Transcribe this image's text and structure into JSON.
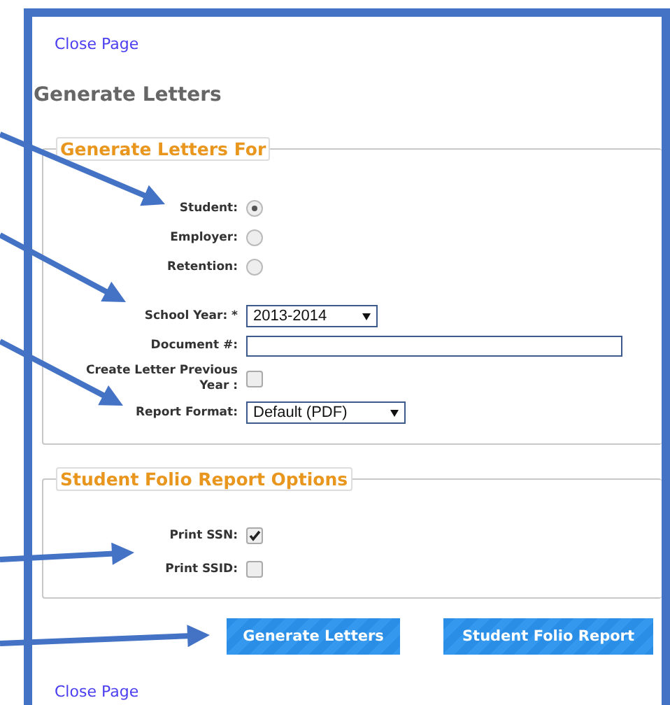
{
  "top_link": "Close Page",
  "title": "Generate Letters",
  "sections": [
    {
      "legend": "Generate Letters For",
      "fields": [
        {
          "kind": "radio",
          "label": "Student:",
          "selected": true
        },
        {
          "kind": "radio",
          "label": "Employer:",
          "selected": false
        },
        {
          "kind": "radio",
          "label": "Retention:",
          "selected": false
        },
        {
          "kind": "select",
          "label": "School Year: *",
          "value": "2013-2014"
        },
        {
          "kind": "text",
          "label": "Document #:"
        },
        {
          "kind": "checkbox",
          "label": "Create Letter Previous Year :",
          "checked": false
        },
        {
          "kind": "select",
          "label": "Report Format:",
          "value": "Default (PDF)"
        }
      ]
    },
    {
      "legend": "Student Folio Report Options",
      "fields": [
        {
          "kind": "checkbox",
          "label": "Print SSN:",
          "checked": true
        },
        {
          "kind": "checkbox",
          "label": "Print SSID:",
          "checked": false
        }
      ]
    }
  ],
  "buttons": [
    "Generate Letters",
    "Student Folio Report"
  ],
  "bottom_link": "Close Page"
}
